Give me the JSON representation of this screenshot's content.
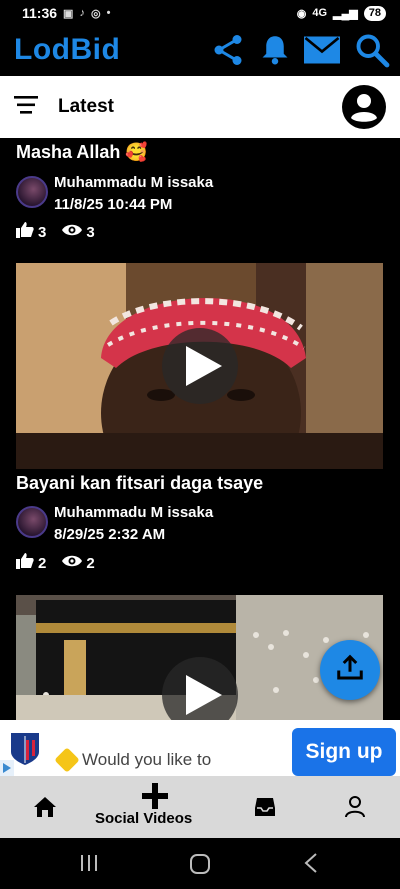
{
  "status": {
    "time": "11:36",
    "battery": "78",
    "network": "4G"
  },
  "app": {
    "title": "LodBid",
    "accent": "#1e88e5"
  },
  "header_icons": [
    "share-icon",
    "bell-icon",
    "mail-icon",
    "search-icon"
  ],
  "filter": {
    "label": "Latest"
  },
  "posts": [
    {
      "title": "Masha Allah 🥰",
      "author": "Muhammadu M issaka",
      "date": "11/8/25 10:44 PM",
      "likes": "3",
      "views": "3"
    },
    {
      "title": "Bayani kan fitsari daga tsaye",
      "author": "Muhammadu M issaka",
      "date": "8/29/25 2:32 AM",
      "likes": "2",
      "views": "2"
    },
    {
      "title": "",
      "author": "",
      "date": "",
      "likes": "",
      "views": ""
    }
  ],
  "ad": {
    "text": "Would you like to",
    "cta": "Sign up"
  },
  "bottom_nav": {
    "center_label": "Social Videos"
  }
}
